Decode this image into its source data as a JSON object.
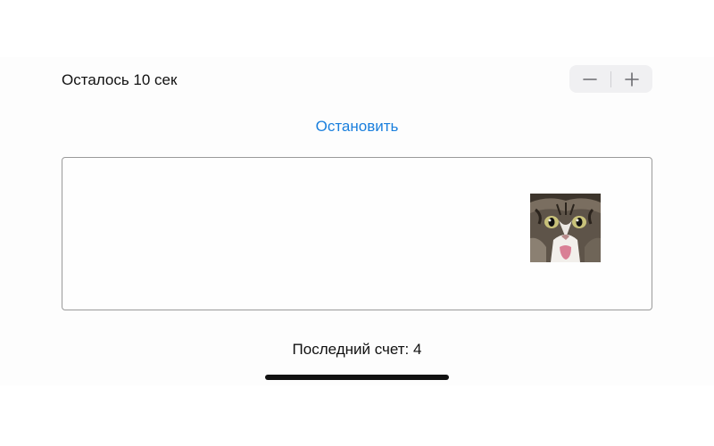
{
  "header": {
    "timer_text": "Осталось 10 сек"
  },
  "stepper": {
    "minus_label": "−",
    "plus_label": "+"
  },
  "controls": {
    "stop_label": "Остановить"
  },
  "game": {
    "cat_icon": "cat-face-icon"
  },
  "footer": {
    "score_text": "Последний счет: 4"
  },
  "colors": {
    "accent": "#1a7fdd",
    "stepper_bg": "#f0f0f2",
    "field_border": "#9a9a9a"
  }
}
